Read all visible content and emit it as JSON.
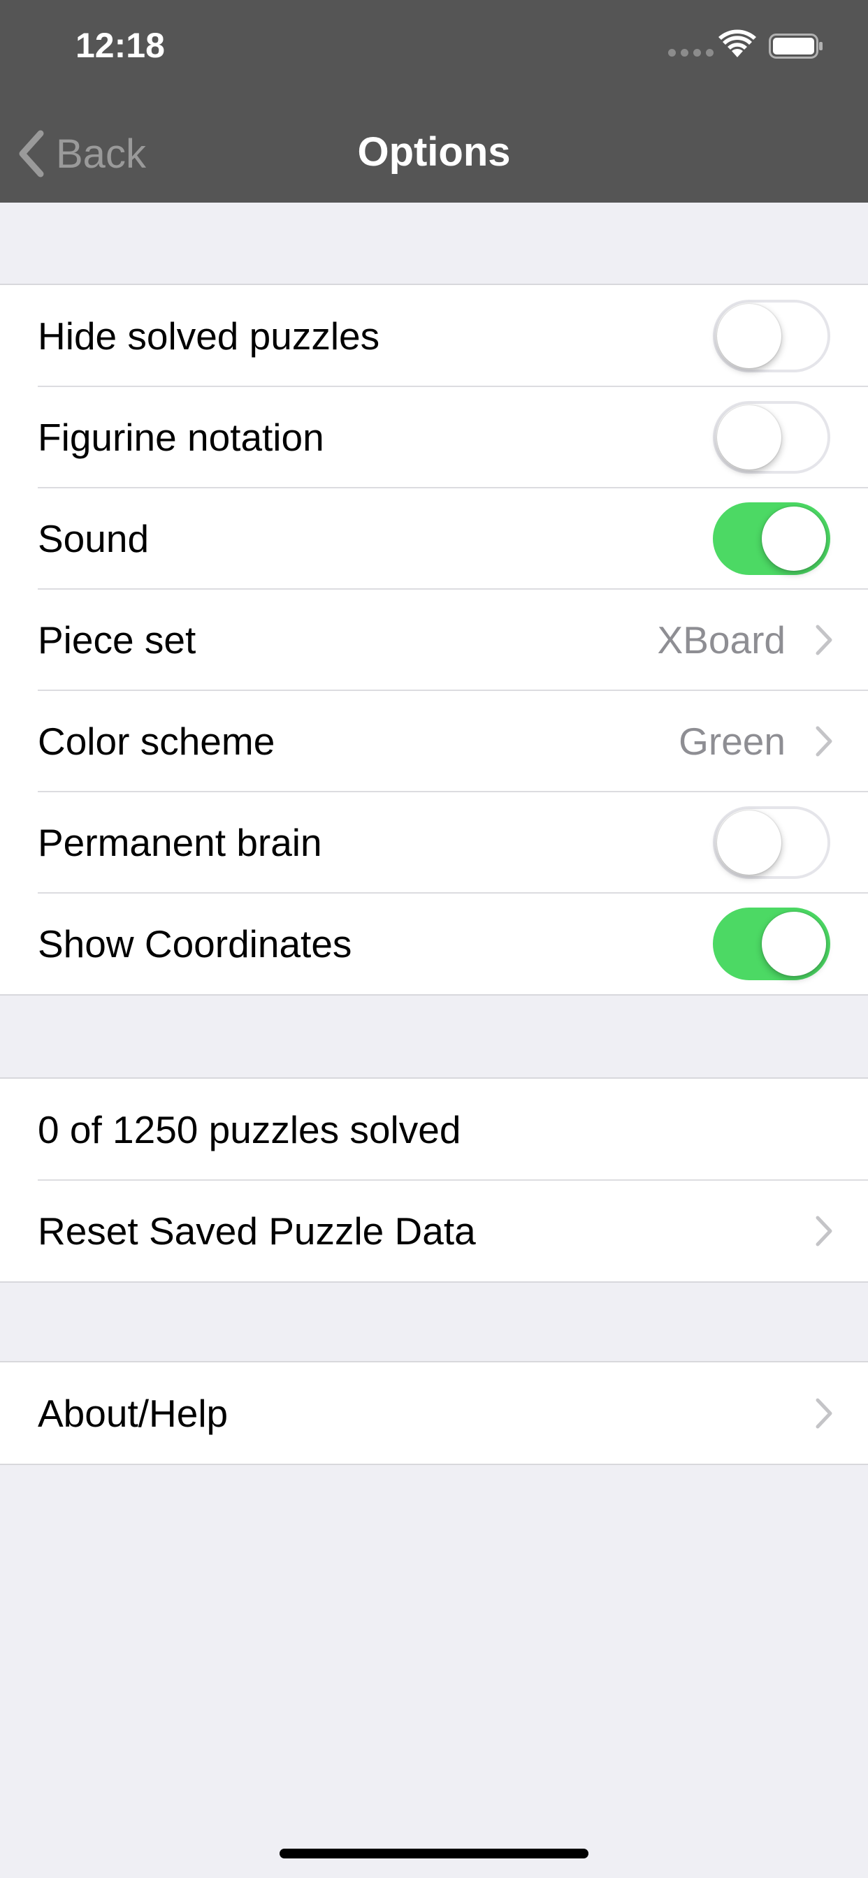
{
  "status_bar": {
    "time": "12:18"
  },
  "nav": {
    "back_label": "Back",
    "title": "Options"
  },
  "settings": [
    {
      "label": "Hide solved puzzles",
      "toggle": false
    },
    {
      "label": "Figurine notation",
      "toggle": false
    },
    {
      "label": "Sound",
      "toggle": true
    },
    {
      "label": "Piece set",
      "value": "XBoard"
    },
    {
      "label": "Color scheme",
      "value": "Green"
    },
    {
      "label": "Permanent brain",
      "toggle": false
    },
    {
      "label": "Show Coordinates",
      "toggle": true
    }
  ],
  "puzzles": {
    "solved_text": "0 of 1250 puzzles solved",
    "reset_label": "Reset Saved Puzzle Data"
  },
  "about": {
    "label": "About/Help"
  },
  "colors": {
    "nav_background": "#555555",
    "toggle_on": "#4cd964",
    "grouped_background": "#efeff4",
    "secondary_text": "#8e8e93"
  }
}
